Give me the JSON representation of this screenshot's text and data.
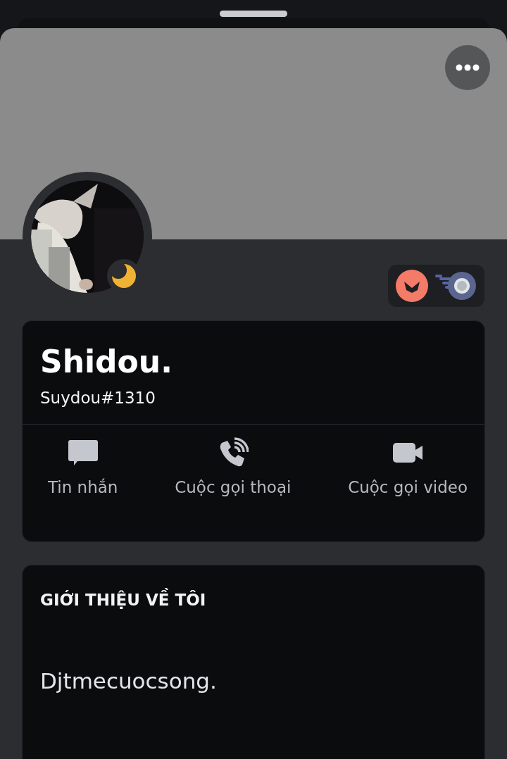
{
  "profile": {
    "display_name": "Shidou.",
    "username": "Suydou#1310",
    "idle": true
  },
  "actions": [
    {
      "kind": "message",
      "label": "Tin nhắn"
    },
    {
      "kind": "voice",
      "label": "Cuộc gọi thoại"
    },
    {
      "kind": "video",
      "label": "Cuộc gọi video"
    }
  ],
  "about": {
    "title": "GIỚI THIỆU VỀ TÔI",
    "text": "Djtmecuocsong."
  }
}
